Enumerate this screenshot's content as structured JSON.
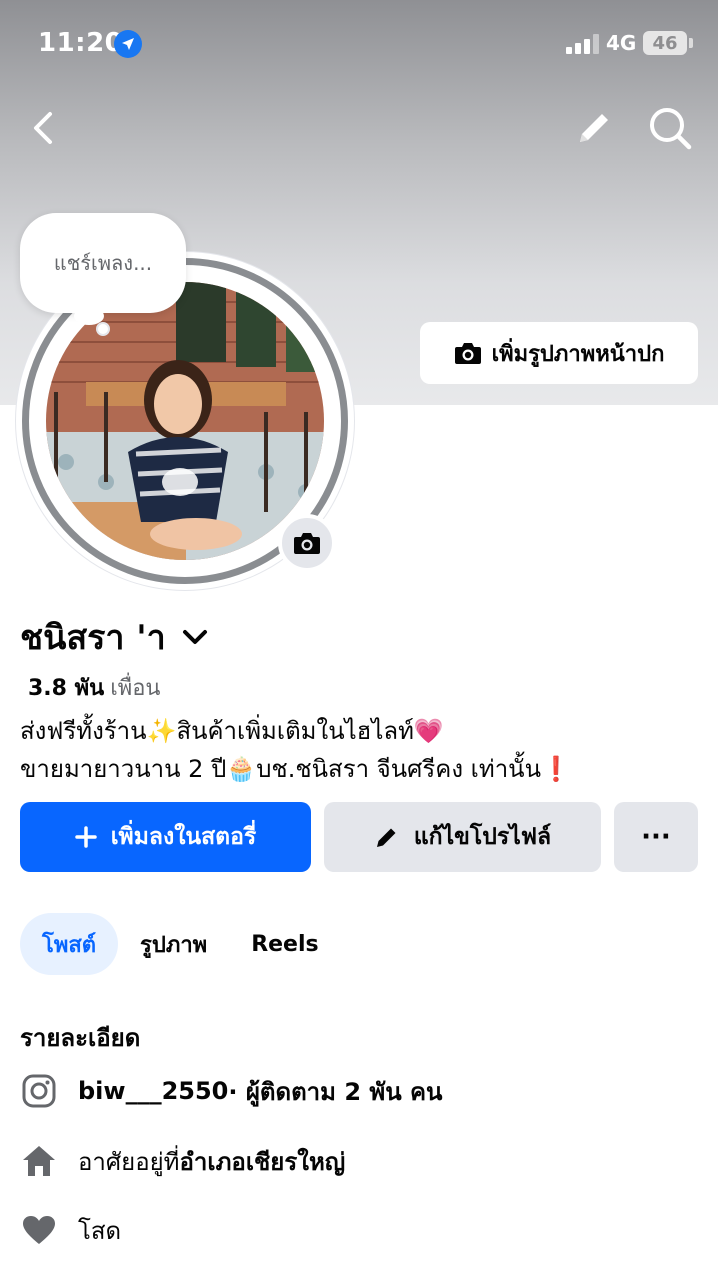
{
  "status_bar": {
    "time": "11:20",
    "network": "4G",
    "battery": "46"
  },
  "cover": {
    "add_cover_label": "เพิ่มรูปภาพหน้าปก"
  },
  "note_bubble": {
    "text": "แชร์เพลง..."
  },
  "profile": {
    "name": "ชนิสรา 'า",
    "friends_count": "3.8 พัน",
    "friends_label": "เพื่อน",
    "bio_line1": "ส่งฟรีทั้งร้าน✨สินค้าเพิ่มเติมในไฮไลท์💗",
    "bio_line2": "ขายมายาวนาน 2 ปี🧁บช.ชนิสรา จีนศรีคง เท่านั้น❗"
  },
  "actions": {
    "add_story": "เพิ่มลงในสตอรี่",
    "edit_profile": "แก้ไขโปรไฟล์",
    "more": "···"
  },
  "tabs": [
    {
      "label": "โพสต์",
      "active": true
    },
    {
      "label": "รูปภาพ",
      "active": false
    },
    {
      "label": "Reels",
      "active": false
    }
  ],
  "details": {
    "title": "รายละเอียด",
    "instagram_handle": "biw___2550",
    "instagram_followers": " · ผู้ติดตาม 2 พัน คน",
    "lives_in_label": "อาศัยอยู่ที่ ",
    "lives_in_place": "อำเภอเชียรใหญ่",
    "relationship": "โสด"
  },
  "colors": {
    "accent": "#0866ff",
    "secondary_button": "#e4e6eb",
    "muted_text": "#65676b"
  }
}
